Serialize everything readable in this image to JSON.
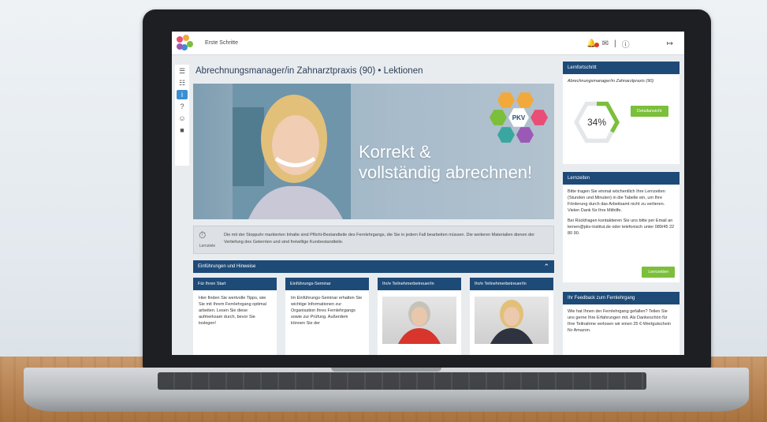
{
  "topbar": {
    "title": "Erste Schritte",
    "icons": [
      "bell-icon",
      "mail-icon",
      "help-icon",
      "logout-icon"
    ],
    "divider": "|"
  },
  "page": {
    "title": "Abrechnungsmanager/in Zahnarztpraxis (90) • Lektionen"
  },
  "hero": {
    "line1": "Korrekt &",
    "line2": "vollständig abrechnen!",
    "badge": "PKV"
  },
  "lernziele": {
    "label": "Lernziele",
    "text": "Die mit der Stoppuhr markierten Inhalte sind Pflicht-Bestandteile des Fernlehrgangs, die Sie in jedem Fall bearbeiten müssen. Die weiteren Materialien dienen der Vertiefung des Gelernten und sind freiwillige Kursbestandteile."
  },
  "section": {
    "title": "Einführungen und Hinweise"
  },
  "cards": [
    {
      "title": "Für Ihren Start",
      "text": "Hier finden Sie wertvolle Tipps, wie Sie mit Ihrem Fernlehrgang optimal arbeiten. Lesen Sie diese aufmerksam durch, bevor Sie loslegen!"
    },
    {
      "title": "Einführungs-Seminar",
      "text": "Im Einführungs-Seminar erhalten Sie wichtige Informationen zur Organisation Ihres Fernlehrgangs sowie zur Prüfung. Außerdem können Sie der"
    },
    {
      "title": "Ihr/e Teilnehmerbetreuer/in",
      "text": ""
    },
    {
      "title": "Ihr/e Teilnehmerbetreuer/in",
      "text": ""
    }
  ],
  "lernfortschritt": {
    "title": "Lernfortschritt",
    "course": "Abrechnungsmanager/in Zahnarztpraxis (90)",
    "percent_label": "34%",
    "progress": 0.34,
    "button": "Detailansicht"
  },
  "lernzeiten": {
    "title": "Lernzeiten",
    "text1": "Bitte tragen Sie einmal wöchentlich Ihre Lernzeiten (Stunden und Minuten) in die Tabelle ein, um Ihre Förderung durch das Arbeitsamt nicht zu verlieren. Vielen Dank für Ihre Mithilfe.",
    "text2": "Bei Rückfragen kontaktieren Sie uns bitte per Email an lernen@pkv-institut.de oder telefonisch unter 089/45 22 80 90.",
    "button": "Lernzeiten"
  },
  "feedback": {
    "title": "Ihr Feedback zum Fernlehrgang",
    "text": "Wie hat Ihnen der Fernlehrgang gefallen? Teilen Sie uns gerne Ihre Erfahrungen mit. Als Dankeschön für Ihre Teilnahme verlosen wir einen 25 €-Wertgutschein für Amazon."
  },
  "colors": {
    "navy": "#1e4a78",
    "green": "#7bbf3a",
    "accent_blue": "#3b8fd1"
  }
}
